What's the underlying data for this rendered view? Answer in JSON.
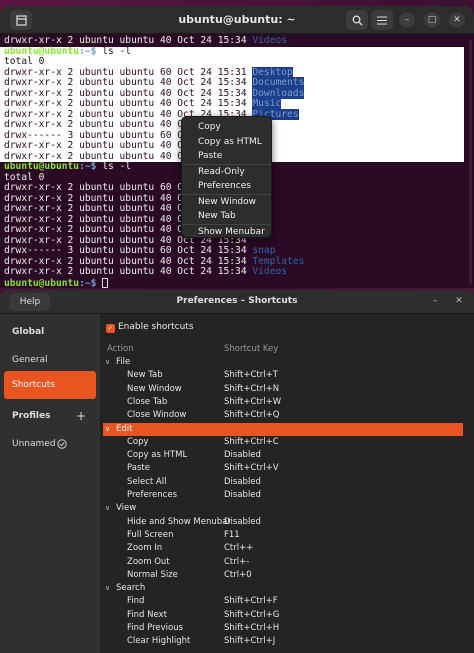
{
  "terminal": {
    "title": "ubuntu@ubuntu: ~",
    "lines": [
      {
        "text": "drwxr-xr-x 2 ubuntu ubuntu 40 Oct 24 15:34 ",
        "dir": "Videos"
      },
      {
        "prompt_user": "ubuntu@ubuntu",
        "prompt_path": ":~$",
        "cmd": " ls -l"
      },
      {
        "text": "total 0"
      },
      {
        "text": "drwxr-xr-x 2 ubuntu ubuntu 60 Oct 24 15:31 ",
        "dir": "Desktop"
      },
      {
        "text": "drwxr-xr-x 2 ubuntu ubuntu 40 Oct 24 15:34 ",
        "dir": "Documents"
      },
      {
        "text": "drwxr-xr-x 2 ubuntu ubuntu 40 Oct 24 15:34 ",
        "dir": "Downloads"
      },
      {
        "text": "drwxr-xr-x 2 ubuntu ubuntu 40 Oct 24 15:34 ",
        "dir": "Music"
      },
      {
        "text": "drwxr-xr-x 2 ubuntu ubuntu 40 Oct 24 15:34 ",
        "dir": "Pictures"
      },
      {
        "text": "drwxr-xr-x 2 ubuntu ubuntu 40 Oct 24 15:34 ",
        "dir": ""
      },
      {
        "text": "drwx------ 3 ubuntu ubuntu 60 Oct 24 15:34 ",
        "dir": ""
      },
      {
        "text": "drwxr-xr-x 2 ubuntu ubuntu 40 Oct 24 15:34 ",
        "dir": ""
      },
      {
        "text": "drwxr-xr-x 2 ubuntu ubuntu 40 Oct 24 15:34 ",
        "dir": ""
      },
      {
        "prompt_user": "ubuntu@ubuntu",
        "prompt_path": ":~$",
        "cmd": " ls -l"
      },
      {
        "text": "total 0"
      },
      {
        "text": "drwxr-xr-x 2 ubuntu ubuntu 60 Oct 24 15:31 ",
        "dir": ""
      },
      {
        "text": "drwxr-xr-x 2 ubuntu ubuntu 40 Oct 24 15:34 ",
        "dir": ""
      },
      {
        "text": "drwxr-xr-x 2 ubuntu ubuntu 40 Oct 24 15:34 ",
        "dir": ""
      },
      {
        "text": "drwxr-xr-x 2 ubuntu ubuntu 40 Oct 24 15:34 ",
        "dir": ""
      },
      {
        "text": "drwxr-xr-x 2 ubuntu ubuntu 40 Oct 24 15:34 ",
        "dir": ""
      },
      {
        "text": "drwxr-xr-x 2 ubuntu ubuntu 40 Oct 24 15:34 ",
        "dir": ""
      },
      {
        "text": "drwx------ 3 ubuntu ubuntu 60 Oct 24 15:34 ",
        "dir": "snap"
      },
      {
        "text": "drwxr-xr-x 2 ubuntu ubuntu 40 Oct 24 15:34 ",
        "dir": "Templates"
      },
      {
        "text": "drwxr-xr-x 2 ubuntu ubuntu 40 Oct 24 15:34 ",
        "dir": "Videos"
      },
      {
        "prompt_user": "ubuntu@ubuntu",
        "prompt_path": ":~$",
        "cmd": " ",
        "cursor": true
      }
    ]
  },
  "context_menu": {
    "groups": [
      [
        "Copy",
        "Copy as HTML",
        "Paste"
      ],
      [
        "Read-Only",
        "Preferences"
      ],
      [
        "New Window",
        "New Tab"
      ],
      [
        "Show Menubar"
      ]
    ]
  },
  "prefs": {
    "help_label": "Help",
    "title": "Preferences – Shortcuts",
    "sidebar": {
      "global": "Global",
      "general": "General",
      "shortcuts": "Shortcuts",
      "profiles": "Profiles",
      "add": "+",
      "unnamed": "Unnamed"
    },
    "enable_label": "Enable shortcuts",
    "col_action": "Action",
    "col_key": "Shortcut Key",
    "groups": [
      {
        "name": "File",
        "rows": [
          [
            "New Tab",
            "Shift+Ctrl+T"
          ],
          [
            "New Window",
            "Shift+Ctrl+N"
          ],
          [
            "Close Tab",
            "Shift+Ctrl+W"
          ],
          [
            "Close Window",
            "Shift+Ctrl+Q"
          ]
        ]
      },
      {
        "name": "Edit",
        "selected": true,
        "rows": [
          [
            "Copy",
            "Shift+Ctrl+C"
          ],
          [
            "Copy as HTML",
            "Disabled"
          ],
          [
            "Paste",
            "Shift+Ctrl+V"
          ],
          [
            "Select All",
            "Disabled"
          ],
          [
            "Preferences",
            "Disabled"
          ]
        ]
      },
      {
        "name": "View",
        "rows": [
          [
            "Hide and Show Menubar",
            "Disabled"
          ],
          [
            "Full Screen",
            "F11"
          ],
          [
            "Zoom In",
            "Ctrl++"
          ],
          [
            "Zoom Out",
            "Ctrl+-"
          ],
          [
            "Normal Size",
            "Ctrl+0"
          ]
        ]
      },
      {
        "name": "Search",
        "rows": [
          [
            "Find",
            "Shift+Ctrl+F"
          ],
          [
            "Find Next",
            "Shift+Ctrl+G"
          ],
          [
            "Find Previous",
            "Shift+Ctrl+H"
          ],
          [
            "Clear Highlight",
            "Shift+Ctrl+J"
          ]
        ]
      }
    ]
  },
  "colors": {
    "accent": "#e95420",
    "terminal_bg": "#2b0a26",
    "dir_blue": "#3465a4",
    "prompt_green": "#8ae234"
  }
}
